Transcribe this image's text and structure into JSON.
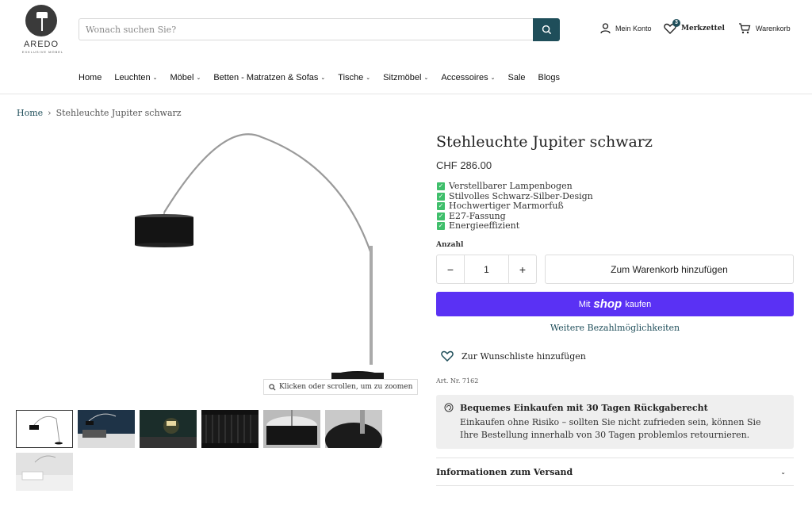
{
  "header": {
    "logo_name": "AREDO",
    "logo_tagline": "EXKLUSIVE MÖBEL",
    "search_placeholder": "Wonach suchen Sie?",
    "account_label": "Mein Konto",
    "wishlist_label": "Merkzettel",
    "wishlist_count": "3",
    "cart_label": "Warenkorb"
  },
  "nav": {
    "items": [
      {
        "label": "Home",
        "dropdown": false
      },
      {
        "label": "Leuchten",
        "dropdown": true
      },
      {
        "label": "Möbel",
        "dropdown": true
      },
      {
        "label": "Betten - Matratzen & Sofas",
        "dropdown": true
      },
      {
        "label": "Tische",
        "dropdown": true
      },
      {
        "label": "Sitzmöbel",
        "dropdown": true
      },
      {
        "label": "Accessoires",
        "dropdown": true
      },
      {
        "label": "Sale",
        "dropdown": false
      },
      {
        "label": "Blogs",
        "dropdown": false
      }
    ]
  },
  "breadcrumb": {
    "home": "Home",
    "separator": "›",
    "current": "Stehleuchte Jupiter schwarz"
  },
  "gallery": {
    "zoom_hint": "Klicken oder scrollen, um zu zoomen",
    "thumbnail_count": 7
  },
  "product": {
    "title": "Stehleuchte Jupiter schwarz",
    "price": "CHF 286.00",
    "features": [
      "Verstellbarer Lampenbogen",
      "Stilvolles Schwarz-Silber-Design",
      "Hochwertiger Marmorfuß",
      "E27-Fassung",
      "Energieeffizient"
    ],
    "quantity_label": "Anzahl",
    "quantity": "1",
    "minus": "−",
    "plus": "+",
    "add_to_cart": "Zum Warenkorb hinzufügen",
    "shop_pay_pre": "Mit",
    "shop_pay_brand": "shop",
    "shop_pay_post": "kaufen",
    "more_payment": "Weitere Bezahlmöglichkeiten",
    "wishlist_add": "Zur Wunschliste hinzufügen",
    "article_nr": "Art. Nr. 7162",
    "guarantee_title": "Bequemes Einkaufen mit 30 Tagen Rückgaberecht",
    "guarantee_text": "Einkaufen ohne Risiko – sollten Sie nicht zufrieden sein, können Sie Ihre Bestellung innerhalb von 30 Tagen problemlos retournieren.",
    "accordion_shipping": "Informationen zum Versand"
  },
  "colors": {
    "accent": "#1f4e5a",
    "shop_pay": "#5a31f4",
    "check": "#3fbf6b"
  }
}
